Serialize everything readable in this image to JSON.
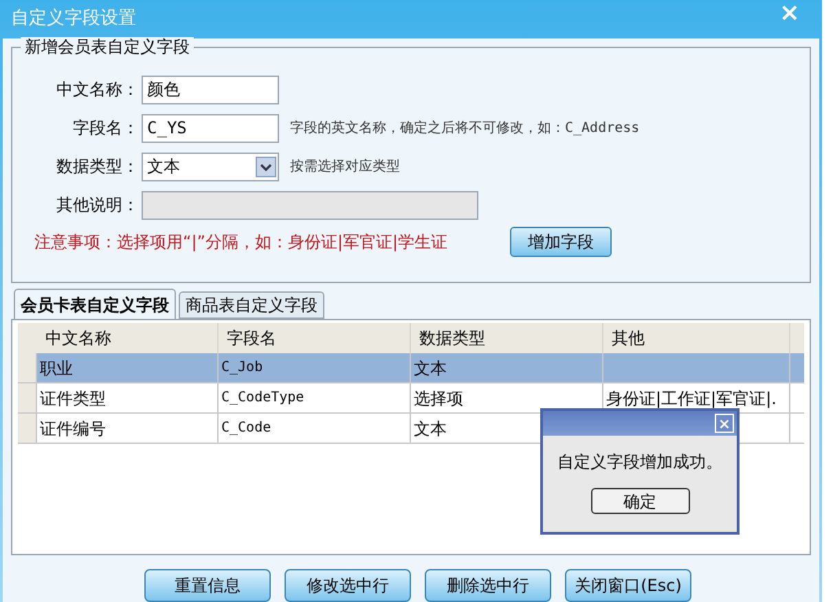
{
  "window": {
    "title": "自定义字段设置",
    "close": "×"
  },
  "group": {
    "title": "新增会员表自定义字段",
    "fields": [
      {
        "kind": "text",
        "label": "中文名称：",
        "value": "颜色"
      },
      {
        "kind": "text",
        "label": "字段名：",
        "value": "C_YS",
        "hint": "字段的英文名称，确定之后将不可修改，如：C_Address"
      },
      {
        "kind": "select",
        "label": "数据类型：",
        "value": "文本",
        "hint": "按需选择对应类型"
      },
      {
        "kind": "text",
        "label": "其他说明：",
        "disabled": true
      }
    ],
    "note": "注意事项：选择项用“|”分隔，如：身份证|军官证|学生证",
    "add_button": "增加字段"
  },
  "tabs": [
    {
      "label": "会员卡表自定义字段",
      "selected": true
    },
    {
      "label": "商品表自定义字段",
      "selected": false
    }
  ],
  "table": {
    "columns": [
      "中文名称",
      "字段名",
      "数据类型",
      "其他"
    ],
    "rows": [
      {
        "selected": true,
        "cells": [
          "职业",
          "C_Job",
          "文本"
        ]
      },
      {
        "selected": false,
        "cells": [
          "证件类型",
          "C_CodeType",
          "选择项",
          "身份证|工作证|军官证|."
        ]
      },
      {
        "selected": false,
        "cells": [
          "证件编号",
          "C_Code",
          "文本"
        ]
      }
    ]
  },
  "buttons": [
    "重置信息",
    "修改选中行",
    "删除选中行",
    "关闭窗口(Esc)"
  ],
  "dialog": {
    "close": "×",
    "message": "自定义字段增加成功。",
    "ok": "确定"
  }
}
